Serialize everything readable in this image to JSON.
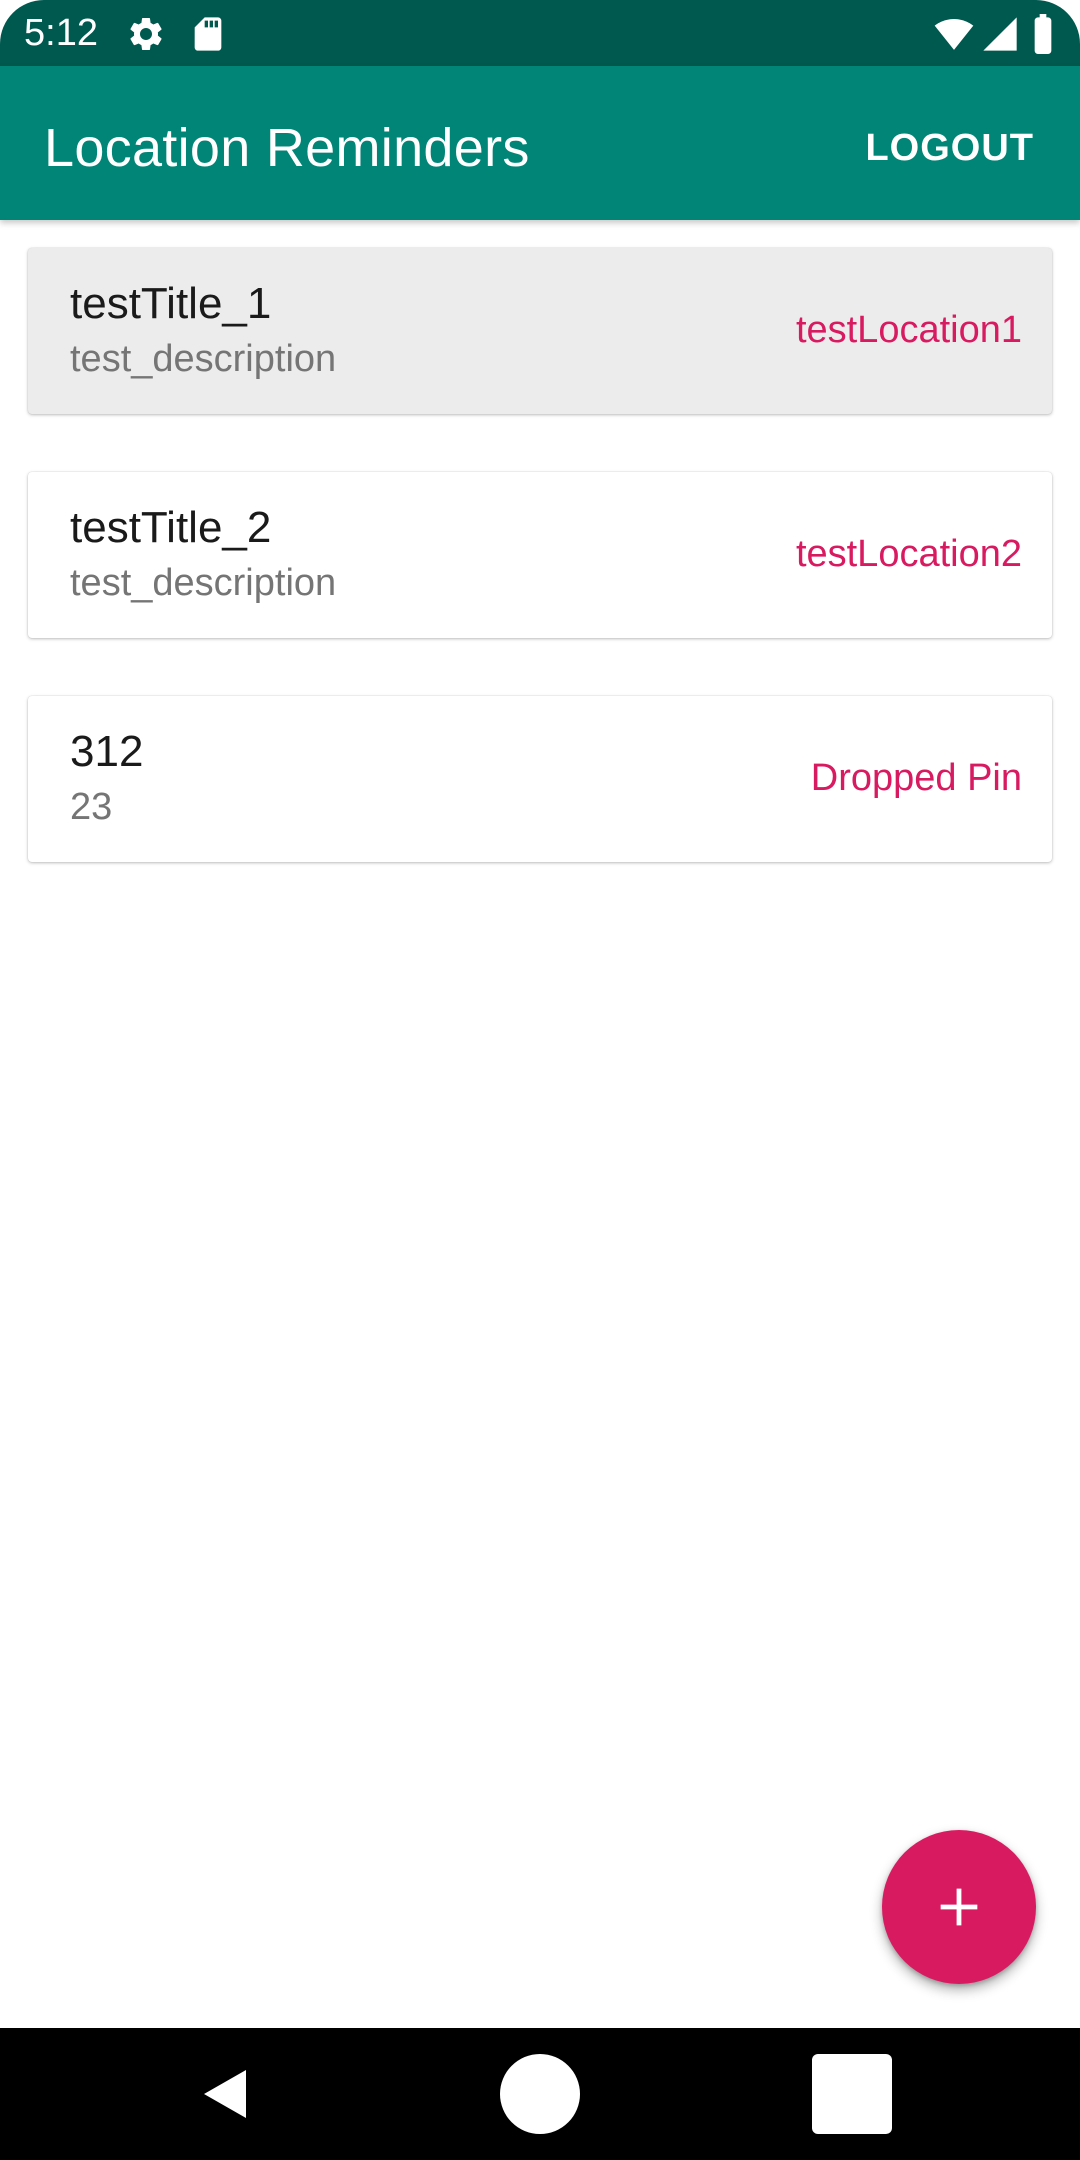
{
  "status_bar": {
    "time": "5:12",
    "left_icons": [
      "gear-icon",
      "sd-card-icon"
    ],
    "right_icons": [
      "wifi-icon",
      "cell-signal-icon",
      "battery-icon"
    ]
  },
  "app_bar": {
    "title": "Location Reminders",
    "logout_label": "LOGOUT",
    "background_color": "#008577"
  },
  "reminders": [
    {
      "title": "testTitle_1",
      "description": "test_description",
      "location": "testLocation1",
      "selected": true
    },
    {
      "title": "testTitle_2",
      "description": "test_description",
      "location": "testLocation2",
      "selected": false
    },
    {
      "title": "312",
      "description": "23",
      "location": "Dropped Pin",
      "selected": false
    }
  ],
  "fab": {
    "icon": "add-icon",
    "color": "#d81b60"
  },
  "nav_bar": {
    "buttons": [
      "back-icon",
      "home-icon",
      "recents-icon"
    ]
  },
  "colors": {
    "status_bar": "#00594e",
    "accent": "#d81b60",
    "title_text": "#1a1a1a",
    "secondary_text": "#757575"
  }
}
